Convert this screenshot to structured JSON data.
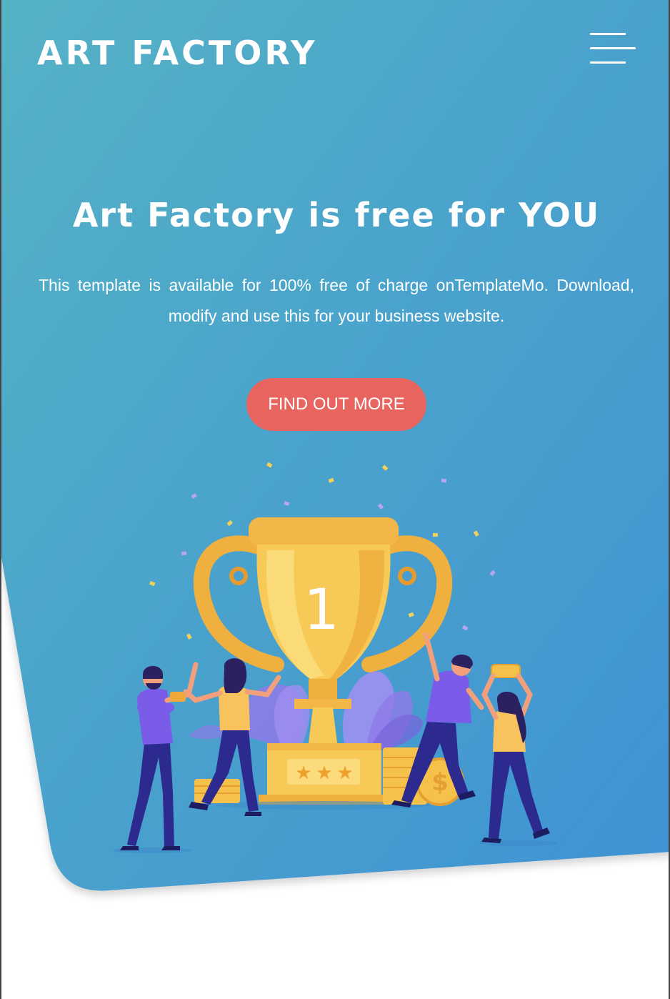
{
  "brand": {
    "logo_text": "ART FACTORY"
  },
  "header": {
    "menu_icon": "hamburger-menu-icon"
  },
  "hero": {
    "title": "Art Factory is free for YOU",
    "description": "This template is available for 100% free of charge onTemplateMo. Download, modify and use this for your business website.",
    "cta_label": "FIND OUT MORE",
    "trophy_number": "1"
  },
  "colors": {
    "gradient_start": "#55b2c5",
    "gradient_end": "#3f93d2",
    "cta": "#e7645f",
    "trophy_gold": "#f5c14b",
    "trophy_dark": "#f0a83a",
    "figure_purple": "#7a5ce8",
    "figure_navy": "#2c2a8f",
    "figure_yellow": "#f8c35d"
  }
}
